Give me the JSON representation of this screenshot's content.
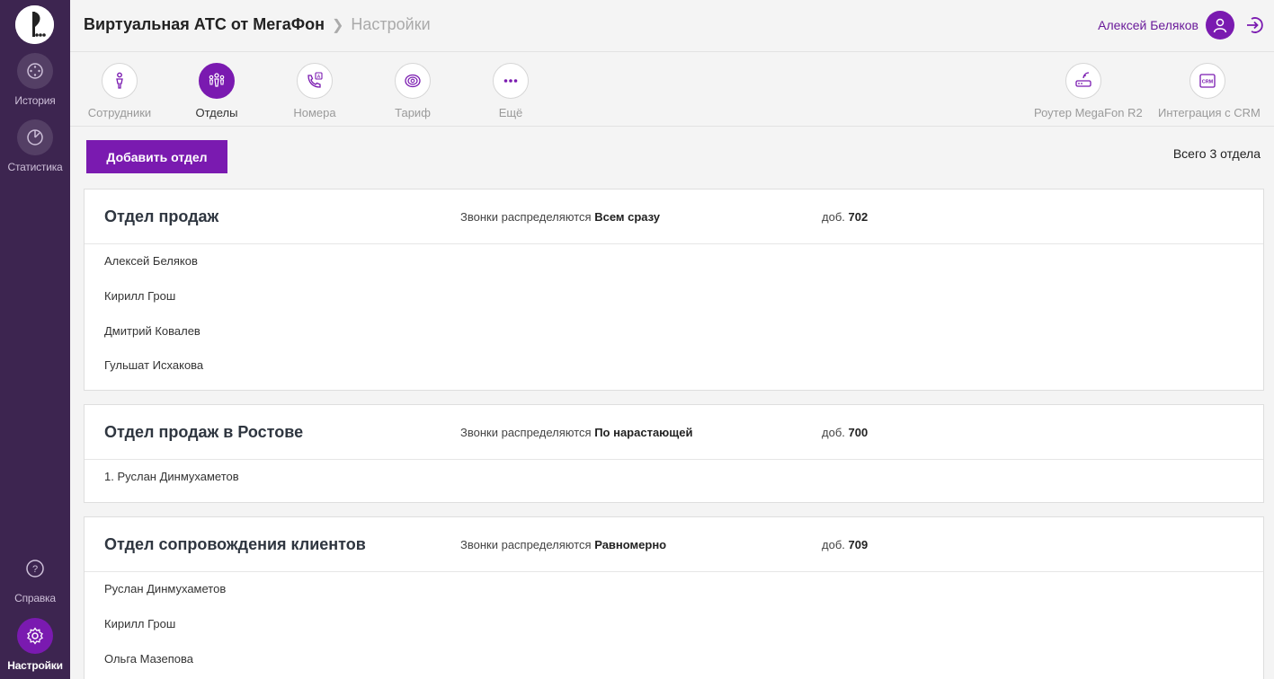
{
  "app": {
    "title": "Виртуальная АТС от МегаФон",
    "section": "Настройки"
  },
  "sidebar": {
    "items": [
      {
        "label": "История",
        "icon": "history-icon"
      },
      {
        "label": "Статистика",
        "icon": "statistics-icon"
      },
      {
        "label": "Справка",
        "icon": "help-icon"
      },
      {
        "label": "Настройки",
        "icon": "settings-icon",
        "active": true
      }
    ]
  },
  "user": {
    "name": "Алексей Беляков"
  },
  "tabs": [
    {
      "label": "Сотрудники",
      "icon": "employee-icon"
    },
    {
      "label": "Отделы",
      "icon": "departments-icon",
      "active": true
    },
    {
      "label": "Номера",
      "icon": "numbers-icon"
    },
    {
      "label": "Тариф",
      "icon": "tariff-icon"
    },
    {
      "label": "Ещё",
      "icon": "more-icon"
    },
    {
      "label": "Роутер MegaFon R2",
      "icon": "router-icon"
    },
    {
      "label": "Интеграция с CRM",
      "icon": "crm-icon",
      "icon_text": "CRM"
    }
  ],
  "actions": {
    "add_department": "Добавить отдел",
    "total": "Всего 3 отдела"
  },
  "departments": [
    {
      "title": "Отдел продаж",
      "dist_prefix": "Звонки распределяются",
      "dist_mode": "Всем сразу",
      "ext_prefix": "доб.",
      "ext": "702",
      "members": [
        "Алексей Беляков",
        "Кирилл Грош",
        "Дмитрий Ковалев",
        "Гульшат Исхакова"
      ]
    },
    {
      "title": "Отдел продаж в Ростове",
      "dist_prefix": "Звонки распределяются",
      "dist_mode": "По нарастающей",
      "ext_prefix": "доб.",
      "ext": "700",
      "members": [
        "1. Руслан Динмухаметов"
      ]
    },
    {
      "title": "Отдел сопровождения клиентов",
      "dist_prefix": "Звонки распределяются",
      "dist_mode": "Равномерно",
      "ext_prefix": "доб.",
      "ext": "709",
      "members": [
        "Руслан Динмухаметов",
        "Кирилл Грош",
        "Ольга Мазепова"
      ]
    }
  ],
  "colors": {
    "accent": "#7a1ab0",
    "sidebar": "#3d2550",
    "megafon_green": "#00b956"
  }
}
